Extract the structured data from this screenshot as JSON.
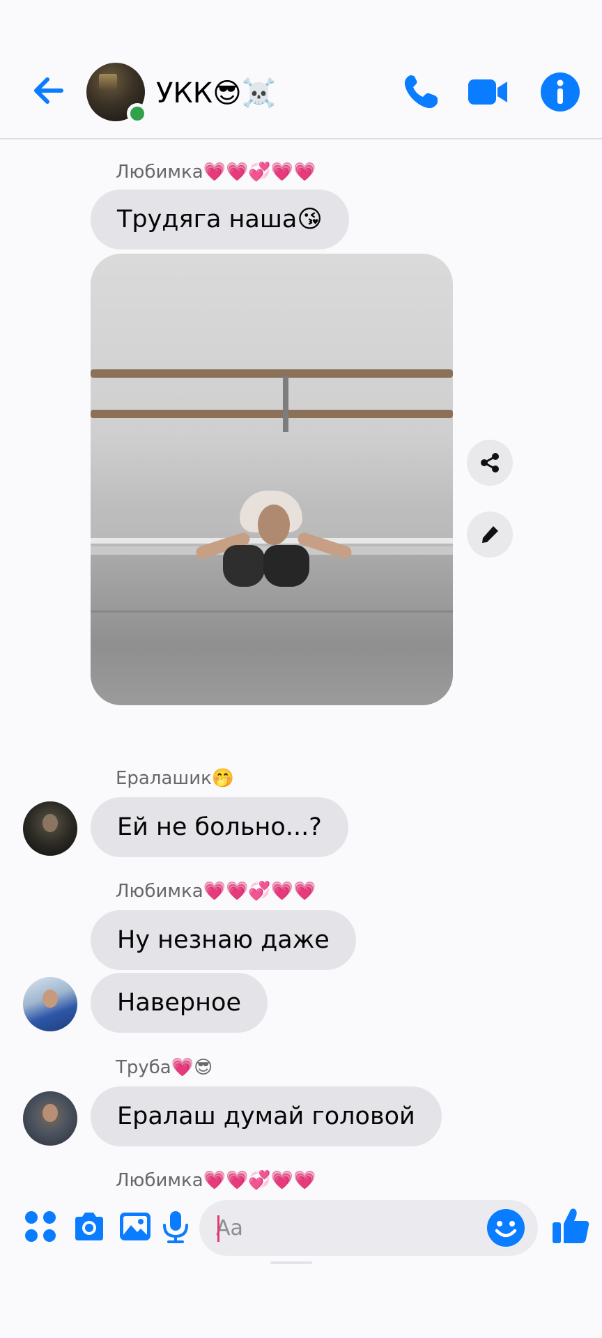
{
  "header": {
    "title": "УКК😎☠️"
  },
  "messages": [
    {
      "sender": "Любимка💗💗💞💗💗",
      "text": "Трудяга наша😘"
    },
    {
      "sender": "Ералашик🤭",
      "text": "Ей не больно...?"
    },
    {
      "sender": "Любимка💗💗💞💗💗",
      "text": "Ну незнаю даже"
    },
    {
      "sender": "",
      "text": "Наверное"
    },
    {
      "sender": "Труба💗😎",
      "text": "Ералаш думай головой"
    },
    {
      "sender": "Любимка💗💗💞💗💗",
      "text": ""
    }
  ],
  "composer": {
    "placeholder": "Aa"
  },
  "colors": {
    "accent": "#0a7cff",
    "bubble": "#e4e4e8",
    "online": "#31a24c",
    "background": "#fafafc"
  },
  "icons": [
    "back-arrow-icon",
    "phone-icon",
    "video-camera-icon",
    "info-icon",
    "share-icon",
    "pencil-icon",
    "apps-grid-icon",
    "camera-icon",
    "image-icon",
    "microphone-icon",
    "smiley-icon",
    "thumbs-up-icon"
  ]
}
